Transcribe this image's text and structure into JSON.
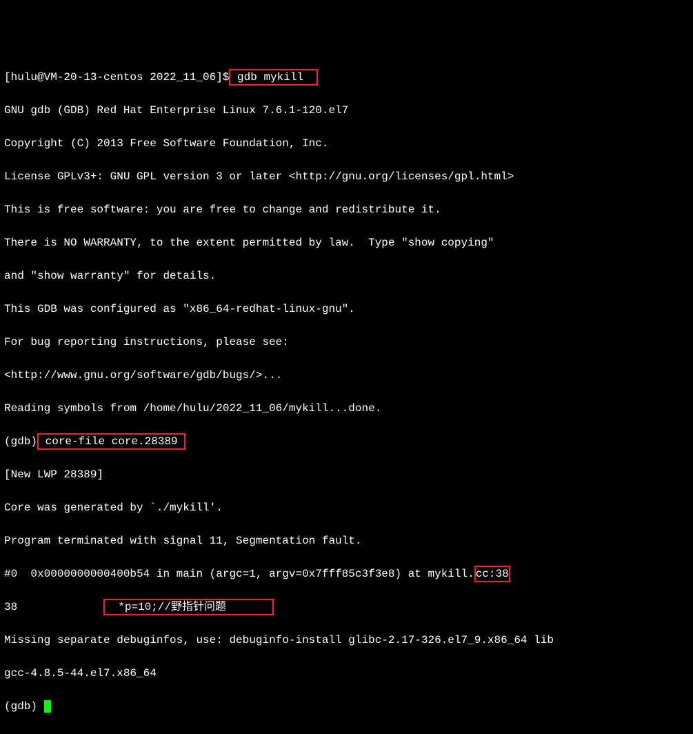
{
  "lines": {
    "l0a": "[hulu@VM-20-13-centos 2022_11_06]$",
    "l0b": " gdb mykill  ",
    "l1": "GNU gdb (GDB) Red Hat Enterprise Linux 7.6.1-120.el7",
    "l2": "Copyright (C) 2013 Free Software Foundation, Inc.",
    "l3": "License GPLv3+: GNU GPL version 3 or later <http://gnu.org/licenses/gpl.html>",
    "l4": "This is free software: you are free to change and redistribute it.",
    "l5": "There is NO WARRANTY, to the extent permitted by law.  Type \"show copying\"",
    "l6": "and \"show warranty\" for details.",
    "l7": "This GDB was configured as \"x86_64-redhat-linux-gnu\".",
    "l8": "For bug reporting instructions, please see:",
    "l9": "<http://www.gnu.org/software/gdb/bugs/>...",
    "l10": "Reading symbols from /home/hulu/2022_11_06/mykill...done.",
    "l11a": "(gdb)",
    "l11b": " core-file core.28389 ",
    "l12": "[New LWP 28389]",
    "l13": "Core was generated by `./mykill'.",
    "l14": "Program terminated with signal 11, Segmentation fault.",
    "l15a": "#0  0x0000000000400b54 in main (argc=1",
    "l15b": ", argv=0x7fff85c3f3e8) at mykill.",
    "l15c": "cc:38",
    "l16a": "38             ",
    "l16b": "  *p=10;//野指针问题       ",
    "l17": "Missing separate debuginfos, use: debuginfo-install glibc-2.17-326.el7_9.x86_64 lib",
    "l18": "gcc-4.8.5-44.el7.x86_64",
    "l19": "(gdb) "
  }
}
